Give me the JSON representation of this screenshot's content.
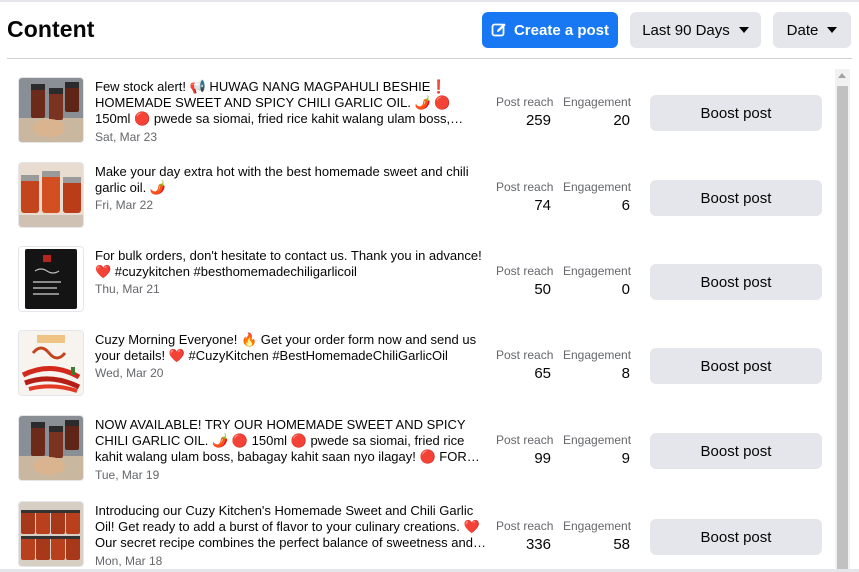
{
  "header": {
    "title": "Content",
    "create_post_label": "Create a post",
    "range_label": "Last 90 Days",
    "sort_label": "Date"
  },
  "metrics": {
    "reach_label": "Post reach",
    "engagement_label": "Engagement"
  },
  "boost_label": "Boost post",
  "posts": [
    {
      "text": "Few stock alert! 📢 HUWAG NANG MAGPAHULI BESHIE❗ HOMEMADE SWEET AND SPICY CHILI GARLIC OIL. 🌶️ 🔴 150ml 🔴 pwede sa siomai, fried rice kahit walang ulam boss, babagay kahit saan nyo ilagay! 🔴 FOR ONLINE ORDERS",
      "date": "Sat, Mar 23",
      "reach": "259",
      "engagement": "20",
      "thumbnail": "chili-jars-in-hand"
    },
    {
      "text": "Make your day extra hot with the best homemade sweet and chili garlic oil. 🌶️",
      "date": "Fri, Mar 22",
      "reach": "74",
      "engagement": "6",
      "thumbnail": "chili-jars-row"
    },
    {
      "text": "For bulk orders, don't hesitate to contact us. Thank you in advance! ❤️ #cuzykitchen #besthomemadechiligarlicoil",
      "date": "Thu, Mar 21",
      "reach": "50",
      "engagement": "0",
      "thumbnail": "contact-card"
    },
    {
      "text": "Cuzy Morning Everyone! 🔥 Get your order form now and send us your details! ❤️ #CuzyKitchen #BestHomemadeChiliGarlicOil",
      "date": "Wed, Mar 20",
      "reach": "65",
      "engagement": "8",
      "thumbnail": "how-to-order"
    },
    {
      "text": "NOW AVAILABLE! TRY OUR HOMEMADE SWEET AND SPICY CHILI GARLIC OIL. 🌶️ 🔴 150ml 🔴 pwede sa siomai, fried rice kahit walang ulam boss, babagay kahit saan nyo ilagay! 🔴 FOR ONLINE ORDERS",
      "date": "Tue, Mar 19",
      "reach": "99",
      "engagement": "9",
      "thumbnail": "chili-jars-in-hand"
    },
    {
      "text": "Introducing our Cuzy Kitchen's Homemade Sweet and Chili Garlic Oil! Get ready to add a burst of flavor to your culinary creations. ❤️Our secret recipe combines the perfect balance of sweetness and heat",
      "date": "Mon, Mar 18",
      "reach": "336",
      "engagement": "58",
      "thumbnail": "chili-jars-stacked"
    }
  ],
  "colors": {
    "primary": "#1877f2",
    "secondary_button": "#e4e6eb",
    "text_secondary": "#65676b"
  }
}
